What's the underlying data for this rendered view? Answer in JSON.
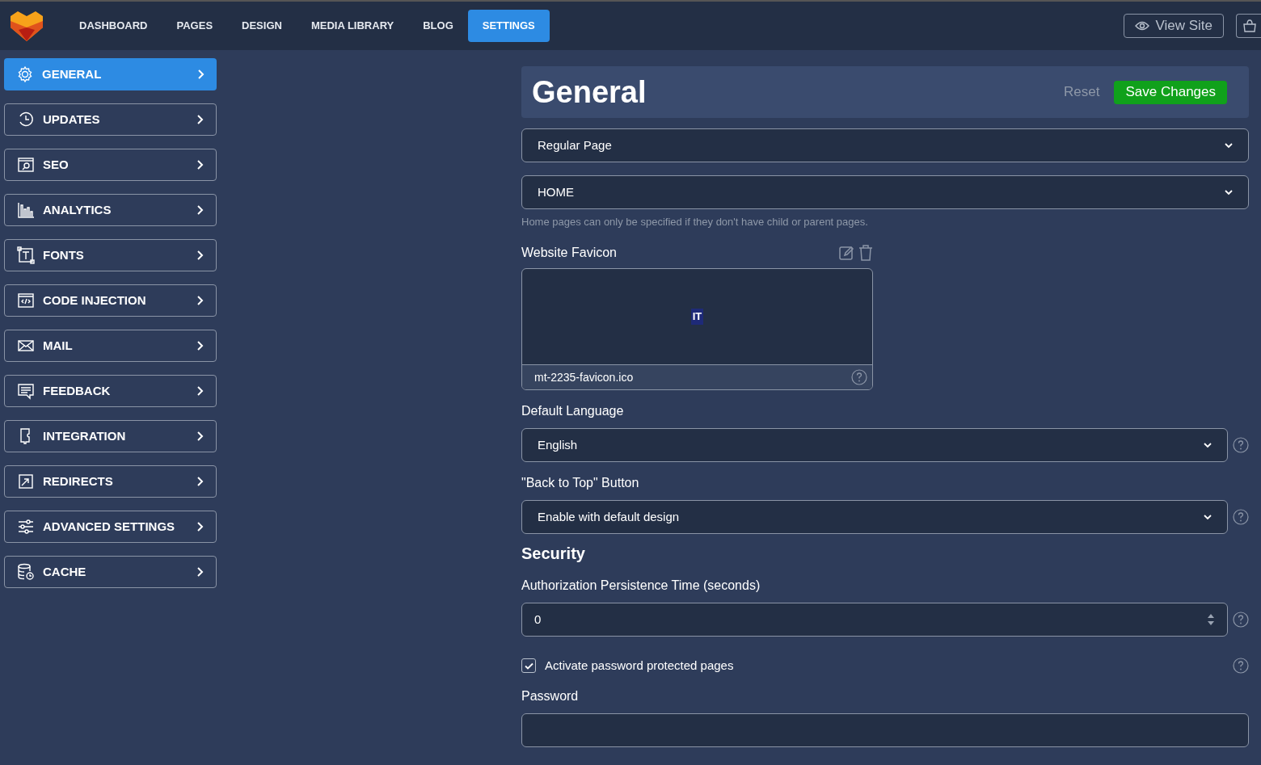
{
  "nav": {
    "items": [
      {
        "label": "DASHBOARD",
        "selected": false
      },
      {
        "label": "PAGES",
        "selected": false
      },
      {
        "label": "DESIGN",
        "selected": false
      },
      {
        "label": "MEDIA LIBRARY",
        "selected": false
      },
      {
        "label": "BLOG",
        "selected": false
      },
      {
        "label": "SETTINGS",
        "selected": true
      }
    ],
    "view_site": "View Site"
  },
  "sidebar": {
    "items": [
      {
        "label": "GENERAL",
        "selected": true
      },
      {
        "label": "UPDATES",
        "selected": false
      },
      {
        "label": "SEO",
        "selected": false
      },
      {
        "label": "ANALYTICS",
        "selected": false
      },
      {
        "label": "FONTS",
        "selected": false
      },
      {
        "label": "CODE INJECTION",
        "selected": false
      },
      {
        "label": "MAIL",
        "selected": false
      },
      {
        "label": "FEEDBACK",
        "selected": false
      },
      {
        "label": "INTEGRATION",
        "selected": false
      },
      {
        "label": "REDIRECTS",
        "selected": false
      },
      {
        "label": "ADVANCED SETTINGS",
        "selected": false
      },
      {
        "label": "CACHE",
        "selected": false
      }
    ]
  },
  "header": {
    "title": "General",
    "reset": "Reset",
    "save": "Save Changes"
  },
  "fields": [
    {
      "kind": "select",
      "value": "Regular Page",
      "help": false
    },
    {
      "kind": "select",
      "value": "HOME",
      "help": false
    },
    {
      "kind": "hint",
      "text": "Home pages can only be specified if they don't have child or parent pages."
    },
    {
      "kind": "favicon",
      "label": "Website Favicon",
      "preview": "IT",
      "file": "mt-2235-favicon.ico"
    },
    {
      "kind": "label",
      "text": "Default Language"
    },
    {
      "kind": "select",
      "value": "English",
      "help": true
    },
    {
      "kind": "label",
      "text": "\"Back to Top\" Button"
    },
    {
      "kind": "select",
      "value": "Enable with default design",
      "help": true
    },
    {
      "kind": "heading",
      "text": "Security"
    },
    {
      "kind": "label",
      "text": "Authorization Persistence Time (seconds)"
    },
    {
      "kind": "number",
      "value": "0",
      "help": true
    },
    {
      "kind": "checkbox",
      "text": "Activate password protected pages",
      "checked": true,
      "help": true
    },
    {
      "kind": "label",
      "text": "Password"
    },
    {
      "kind": "password"
    }
  ]
}
